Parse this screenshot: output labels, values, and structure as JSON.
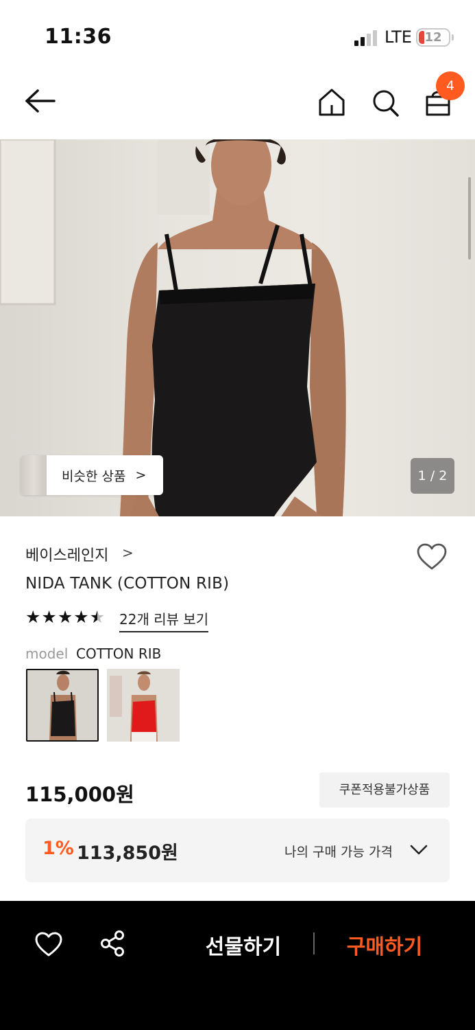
{
  "status_bar": {
    "time": "11:36",
    "network": "LTE",
    "battery": "12",
    "battery_color": "#e5483a"
  },
  "nav": {
    "back_icon": "arrow-left-icon",
    "home_icon": "home-icon",
    "search_icon": "search-icon",
    "cart_icon": "shopping-bag-icon",
    "cart_count": "4",
    "badge_color": "#ff5a1f"
  },
  "hero": {
    "similar_label": "비슷한 상품",
    "similar_chevron": ">",
    "page_indicator": "1 / 2"
  },
  "product": {
    "brand": "베이스레인지",
    "brand_chevron": ">",
    "title": "NIDA TANK (COTTON RIB)",
    "rating": 4.5,
    "rating_max": 5,
    "reviews_link": "22개 리뷰 보기",
    "model_label": "model",
    "model_value": "COTTON RIB",
    "swatches": [
      {
        "name": "black",
        "color": "#1a1a1a",
        "selected": true
      },
      {
        "name": "red",
        "color": "#e0191b",
        "selected": false
      }
    ]
  },
  "price": {
    "original": "115,000원",
    "coupon_label": "쿠폰적용불가상품",
    "discount_rate": "1%",
    "discount_price": "113,850원",
    "my_price_label": "나의 구매 가능 가격"
  },
  "bottom_bar": {
    "heart_icon": "heart-outline-icon",
    "share_icon": "share-icon",
    "gift_label": "선물하기",
    "buy_label": "구매하기",
    "accent_color": "#ff5a1f"
  }
}
